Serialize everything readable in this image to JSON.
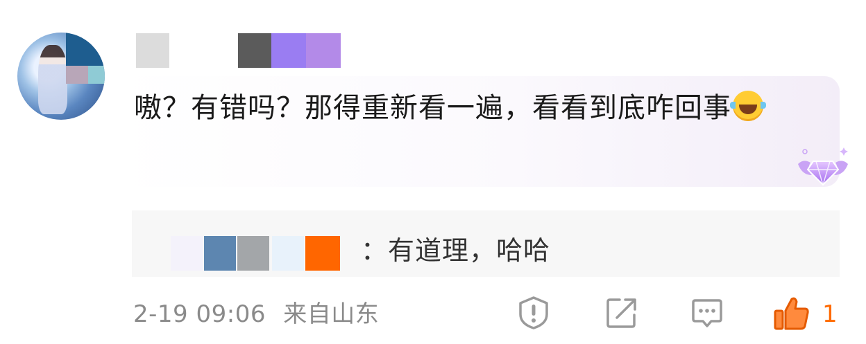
{
  "comment": {
    "text": "嗷？有错吗？那得重新看一遍，看看到底咋回事",
    "emoji": "laugh-cry-emoji"
  },
  "reply": {
    "text": "：有道理，哈哈"
  },
  "meta": {
    "time": "2-19 09:06",
    "location": "来自山东"
  },
  "actions": {
    "like_count": "1"
  },
  "colors": {
    "accent": "#ff6a00",
    "meta_gray": "#8a8a8a",
    "reply_bg": "#f7f7f7"
  }
}
